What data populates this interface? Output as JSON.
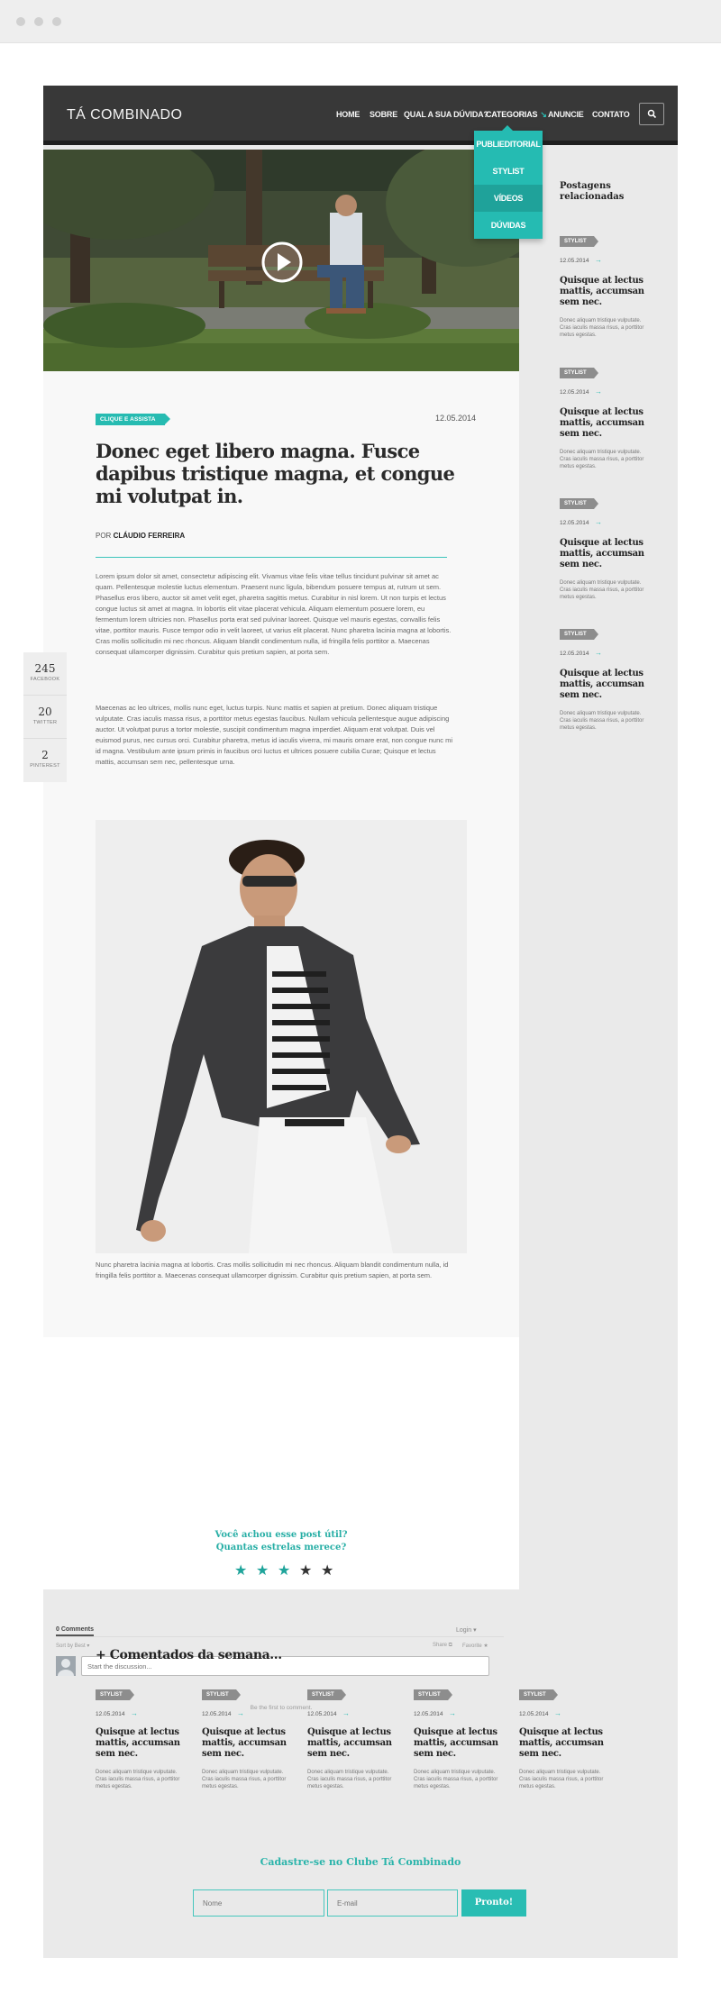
{
  "site": {
    "logo": "TÁ COMBINADO"
  },
  "nav": {
    "items": [
      "HOME",
      "SOBRE",
      "QUAL A SUA DÚVIDA?",
      "CATEGORIAS",
      "ANUNCIE",
      "CONTATO"
    ],
    "active": "CATEGORIAS",
    "dropdown": [
      "PUBLIEDITORIAL",
      "STYLIST",
      "VÍDEOS",
      "DÚVIDAS"
    ],
    "dropdown_selected": "VÍDEOS"
  },
  "post": {
    "category": "CLIQUE E ASSISTA",
    "date": "12.05.2014",
    "title": "Donec eget libero magna. Fusce dapibus tristique magna, et congue mi volutpat in.",
    "byline_prefix": "POR",
    "author": "CLÁUDIO FERREIRA",
    "paragraphs": [
      "Lorem ipsum dolor sit amet, consectetur adipiscing elit. Vivamus vitae felis vitae tellus tincidunt pulvinar sit amet ac quam. Pellentesque molestie luctus elementum. Praesent nunc ligula, bibendum posuere tempus at, rutrum ut sem. Phasellus eros libero, auctor sit amet velit eget, pharetra sagittis metus. Curabitur in nisl lorem. Ut non turpis et lectus congue luctus sit amet at magna. In lobortis elit vitae placerat vehicula. Aliquam elementum posuere lorem, eu fermentum lorem ultricies non. Phasellus porta erat sed pulvinar laoreet. Quisque vel mauris egestas, convallis felis vitae, porttitor mauris. Fusce tempor odio in velit laoreet, ut varius elit placerat. Nunc pharetra lacinia magna at lobortis. Cras mollis sollicitudin mi nec rhoncus. Aliquam blandit condimentum nulla, id fringilla felis porttitor a. Maecenas consequat ullamcorper dignissim. Curabitur quis pretium sapien, at porta sem.",
      "Maecenas ac leo ultrices, mollis nunc eget, luctus turpis. Nunc mattis et sapien at pretium. Donec aliquam tristique vulputate. Cras iaculis massa risus, a porttitor metus egestas faucibus. Nullam vehicula pellentesque augue adipiscing auctor. Ut volutpat purus a tortor molestie, suscipit condimentum magna imperdiet. Aliquam erat volutpat. Duis vel euismod purus, nec cursus orci. Curabitur pharetra, metus id iaculis viverra, mi mauris ornare erat, non congue nunc mi id magna. Vestibulum ante ipsum primis in faucibus orci luctus et ultrices posuere cubilia Curae; Quisque et lectus mattis, accumsan sem nec, pellentesque urna.",
      "Nunc pharetra lacinia magna at lobortis. Cras mollis sollicitudin mi nec rhoncus. Aliquam blandit condimentum nulla, id fringilla felis porttitor a. Maecenas consequat ullamcorper dignissim. Curabitur quis pretium sapien, at porta sem."
    ]
  },
  "shares": [
    {
      "count": "245",
      "label": "FACEBOOK"
    },
    {
      "count": "20",
      "label": "TWITTER"
    },
    {
      "count": "2",
      "label": "PINTEREST"
    }
  ],
  "rating": {
    "line1": "Você achou esse post útil?",
    "line2": "Quantas estrelas merece?",
    "value": 3,
    "max": 5
  },
  "comments": {
    "count_label": "0 Comments",
    "login": "Login ▾",
    "sort": "Sort by Best ▾",
    "share": "Share ⧉",
    "favorite": "Favorite ★",
    "placeholder": "Start the discussion...",
    "empty": "Be the first to comment."
  },
  "sidebar": {
    "title_line1": "Postagens",
    "title_line2": "relacionadas",
    "cards": [
      {
        "tag": "STYLIST",
        "date": "12.05.2014",
        "title": "Quisque at lectus mattis, accumsan sem nec.",
        "excerpt": "Donec aliquam tristique vulputate. Cras iaculis massa risus, a porttitor metus egestas."
      },
      {
        "tag": "STYLIST",
        "date": "12.05.2014",
        "title": "Quisque at lectus mattis, accumsan sem nec.",
        "excerpt": "Donec aliquam tristique vulputate. Cras iaculis massa risus, a porttitor metus egestas."
      },
      {
        "tag": "STYLIST",
        "date": "12.05.2014",
        "title": "Quisque at lectus mattis, accumsan sem nec.",
        "excerpt": "Donec aliquam tristique vulputate. Cras iaculis massa risus, a porttitor metus egestas."
      },
      {
        "tag": "STYLIST",
        "date": "12.05.2014",
        "title": "Quisque at lectus mattis, accumsan sem nec.",
        "excerpt": "Donec aliquam tristique vulputate. Cras iaculis massa risus, a porttitor metus egestas."
      }
    ]
  },
  "week": {
    "title": "+ Comentados da semana...",
    "cards": [
      {
        "tag": "STYLIST",
        "date": "12.05.2014",
        "title": "Quisque at lectus mattis, accumsan sem nec.",
        "excerpt": "Donec aliquam tristique vulputate. Cras iaculis massa risus, a porttitor metus egestas."
      },
      {
        "tag": "STYLIST",
        "date": "12.05.2014",
        "title": "Quisque at lectus mattis, accumsan sem nec.",
        "excerpt": "Donec aliquam tristique vulputate. Cras iaculis massa risus, a porttitor metus egestas."
      },
      {
        "tag": "STYLIST",
        "date": "12.05.2014",
        "title": "Quisque at lectus mattis, accumsan sem nec.",
        "excerpt": "Donec aliquam tristique vulputate. Cras iaculis massa risus, a porttitor metus egestas."
      },
      {
        "tag": "STYLIST",
        "date": "12.05.2014",
        "title": "Quisque at lectus mattis, accumsan sem nec.",
        "excerpt": "Donec aliquam tristique vulputate. Cras iaculis massa risus, a porttitor metus egestas."
      },
      {
        "tag": "STYLIST",
        "date": "12.05.2014",
        "title": "Quisque at lectus mattis, accumsan sem nec.",
        "excerpt": "Donec aliquam tristique vulputate. Cras iaculis massa risus, a porttitor metus egestas."
      }
    ]
  },
  "newsletter": {
    "title": "Cadastre-se no Clube Tá Combinado",
    "name_placeholder": "Nome",
    "email_placeholder": "E-mail",
    "button": "Pronto!"
  },
  "colors": {
    "accent": "#26bbb1",
    "header": "#383838",
    "tag": "#8d8d8d",
    "star_on": "#1fa49b",
    "star_off": "#333333"
  },
  "icons": {
    "search": "search-icon",
    "play": "play-icon",
    "arrow": "arrow-right-icon",
    "caret": "chevron-down-icon"
  }
}
